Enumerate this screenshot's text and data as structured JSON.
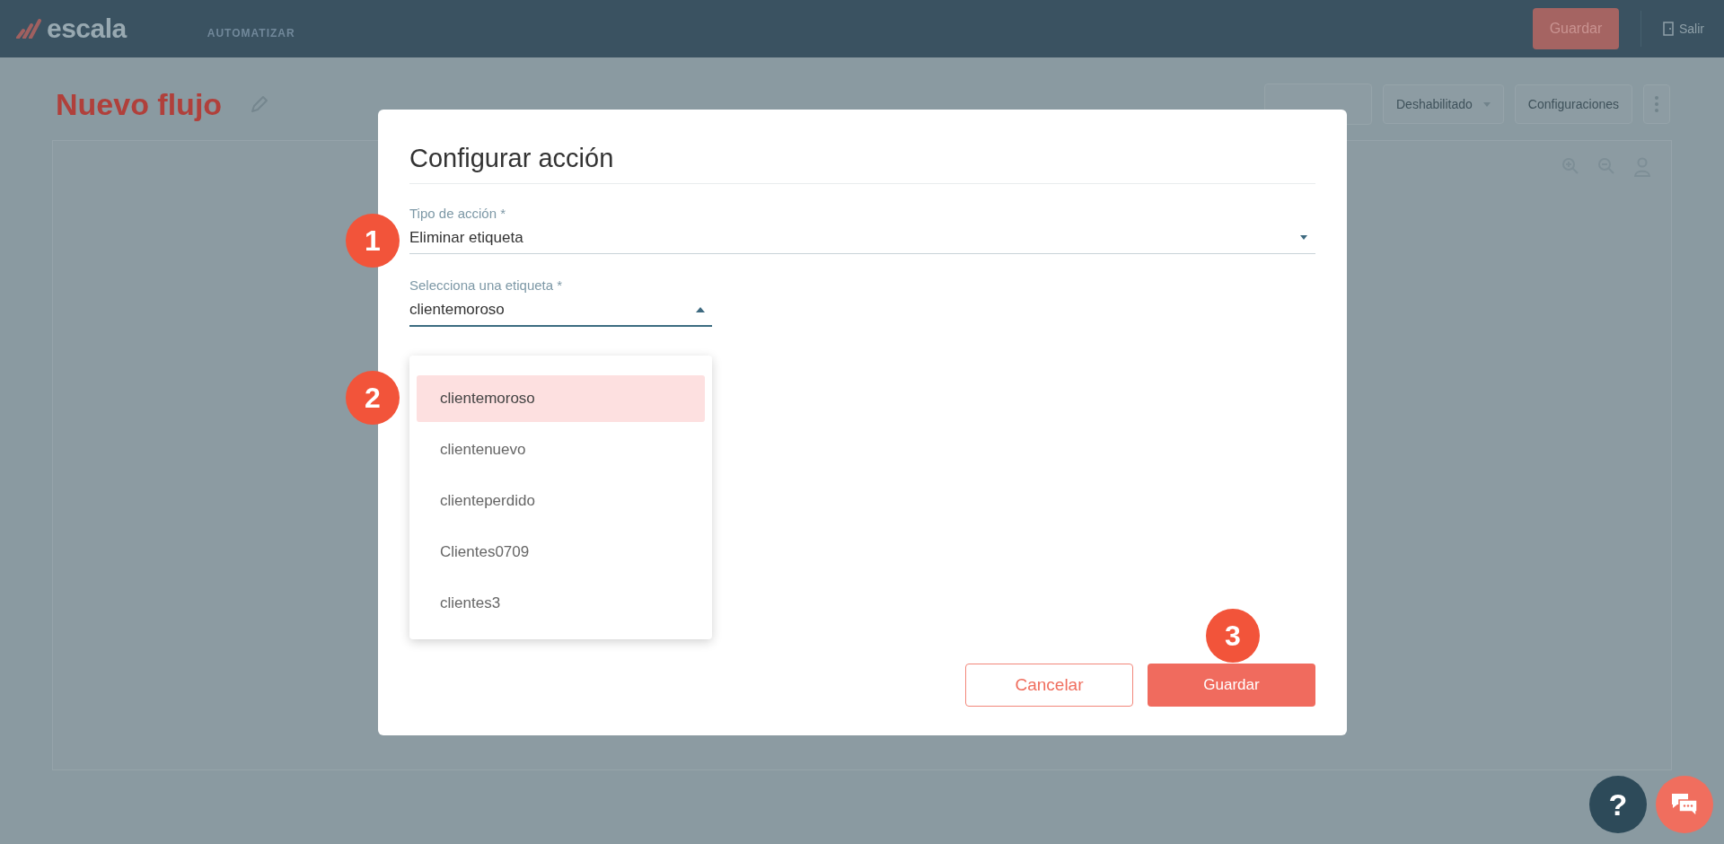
{
  "topbar": {
    "logo": "escala",
    "nav": [
      {
        "label": "AUTOMATIZAR",
        "selected": true
      }
    ],
    "save_button": "Guardar",
    "exit_button": "Salir"
  },
  "page": {
    "title": "Nuevo flujo",
    "status_dropdown": "Deshabilitado",
    "settings_button": "Configuraciones"
  },
  "modal": {
    "title": "Configurar acción",
    "fields": [
      {
        "label": "Tipo de acción *",
        "value": "Eliminar etiqueta",
        "open": false
      },
      {
        "label": "Selecciona una etiqueta *",
        "value": "clientemoroso",
        "open": true
      }
    ],
    "options": [
      {
        "label": "clientemoroso",
        "selected": true
      },
      {
        "label": "clientenuevo",
        "selected": false
      },
      {
        "label": "clienteperdido",
        "selected": false
      },
      {
        "label": "Clientes0709",
        "selected": false
      },
      {
        "label": "clientes3",
        "selected": false
      }
    ],
    "cancel_button": "Cancelar",
    "save_button": "Guardar"
  },
  "callouts": [
    "1",
    "2",
    "3"
  ],
  "help_button": "?"
}
